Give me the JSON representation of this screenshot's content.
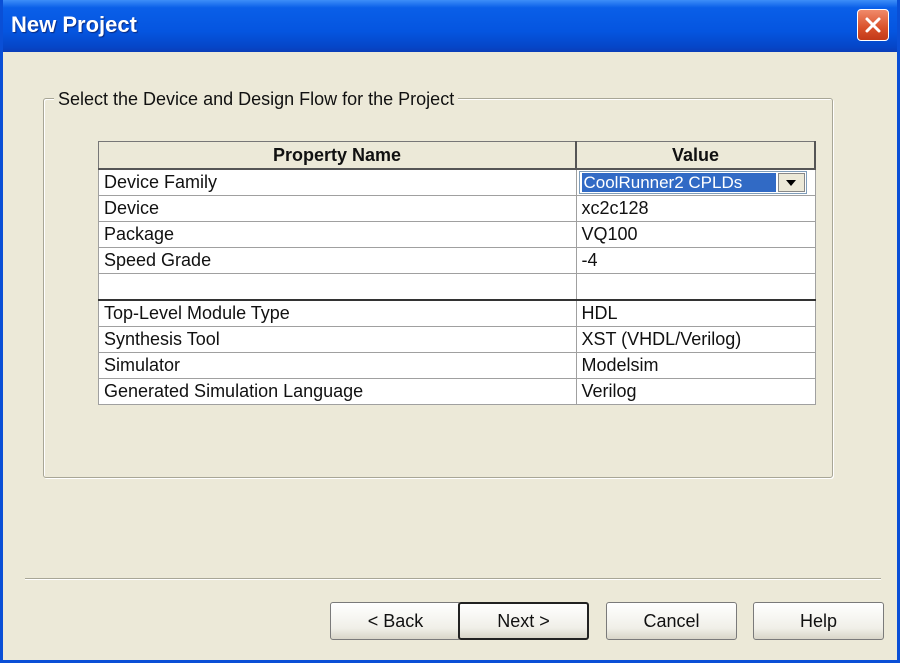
{
  "window": {
    "title": "New Project"
  },
  "group": {
    "label": "Select the Device and Design Flow for the Project"
  },
  "table": {
    "headers": [
      "Property Name",
      "Value"
    ],
    "rows": [
      {
        "name": "Device Family",
        "value": "CoolRunner2 CPLDs"
      },
      {
        "name": "Device",
        "value": "xc2c128"
      },
      {
        "name": "Package",
        "value": "VQ100"
      },
      {
        "name": "Speed Grade",
        "value": "-4"
      },
      {
        "name": "",
        "value": ""
      },
      {
        "name": "Top-Level Module Type",
        "value": "HDL"
      },
      {
        "name": "Synthesis Tool",
        "value": "XST (VHDL/Verilog)"
      },
      {
        "name": "Simulator",
        "value": "Modelsim"
      },
      {
        "name": "Generated Simulation Language",
        "value": "Verilog"
      }
    ]
  },
  "buttons": {
    "back": "< Back",
    "next": "Next >",
    "cancel": "Cancel",
    "help": "Help"
  },
  "icons": {
    "close": "close-icon",
    "dropdown": "chevron-down-icon"
  },
  "colors": {
    "titlebar": "#0555e0",
    "selection": "#316ac5",
    "dialog_bg": "#ece9d8"
  }
}
